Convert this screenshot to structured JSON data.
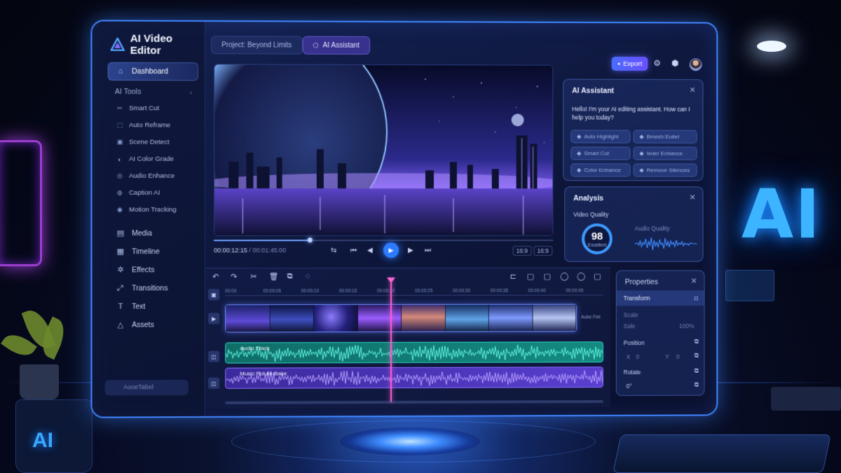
{
  "app": {
    "title": "AI Video Editor"
  },
  "sidebar": {
    "dashboard": "Dashboard",
    "ai_tools_label": "AI Tools",
    "ai_tools": [
      {
        "label": "Smart Cut",
        "icon": "scissors-icon"
      },
      {
        "label": "Auto Reframe",
        "icon": "reframe-icon"
      },
      {
        "label": "Scene Detect",
        "icon": "scene-icon"
      },
      {
        "label": "AI Color Grade",
        "icon": "palette-icon"
      },
      {
        "label": "Audio Enhance",
        "icon": "audio-icon"
      },
      {
        "label": "Caption AI",
        "icon": "caption-icon"
      },
      {
        "label": "Motion Tracking",
        "icon": "motion-icon"
      }
    ],
    "items": [
      {
        "label": "Media",
        "icon": "media-icon"
      },
      {
        "label": "Timeline",
        "icon": "timeline-icon"
      },
      {
        "label": "Effects",
        "icon": "effects-icon"
      },
      {
        "label": "Transitions",
        "icon": "transitions-icon"
      },
      {
        "label": "Text",
        "icon": "text-icon"
      },
      {
        "label": "Assets",
        "icon": "assets-icon"
      }
    ],
    "bottom_label": "AooeTabel"
  },
  "tabs": {
    "project": "Project: Beyond Limits",
    "assistant": "AI Assistant"
  },
  "toolbar": {
    "export_label": "Export"
  },
  "player": {
    "time_current": "00:00:12:15",
    "time_total": " / 00:01:45:00",
    "ratio_a": "16:9",
    "ratio_b": "16:9",
    "progress": 0.28
  },
  "assistant_panel": {
    "title": "AI Assistant",
    "message": "Hello! I'm your AI editing assistant. How can I help you today?",
    "chips": [
      "Auto Highlight",
      "Bmesh:Euilet",
      "Smart Cut",
      "Ieder Enhance",
      "Color Enhance",
      "Remove Silences"
    ]
  },
  "analysis_panel": {
    "title": "Analysis",
    "video_quality_label": "Video Quality",
    "video_quality_score": "98",
    "video_quality_caption": "Excellent",
    "score_fraction": 0.98,
    "audio_quality_label": "Audio Quality"
  },
  "timeline": {
    "ruler": [
      "00:00",
      "00:00:05",
      "00:00:10",
      "00:00:15",
      "00:00:20",
      "00:00:25",
      "00:00:30",
      "00:00:35",
      "00:00:40",
      "00:00:45"
    ],
    "video_tag": "Aube Fiet",
    "audio_track_1": "Audio Track",
    "audio_track_2": "Music  Future Bake"
  },
  "properties": {
    "title": "Properties",
    "transform_label": "Transform",
    "scale_label": "Scale",
    "scale_sub": "Sale",
    "scale_value": "100%",
    "position_label": "Position",
    "pos_x_label": "X",
    "pos_x_value": "0",
    "pos_y_label": "Y",
    "pos_y_value": "0",
    "rotate_label": "Rotate",
    "rotate_value": "0°"
  },
  "background": {
    "sign_text": "AI",
    "mug_text": "AI"
  },
  "colors": {
    "accent": "#3f86ff",
    "play": "#2d7bff",
    "playhead": "#ff5fd2",
    "audio1": "#1fb3a0",
    "audio2": "#6b4ae6"
  }
}
